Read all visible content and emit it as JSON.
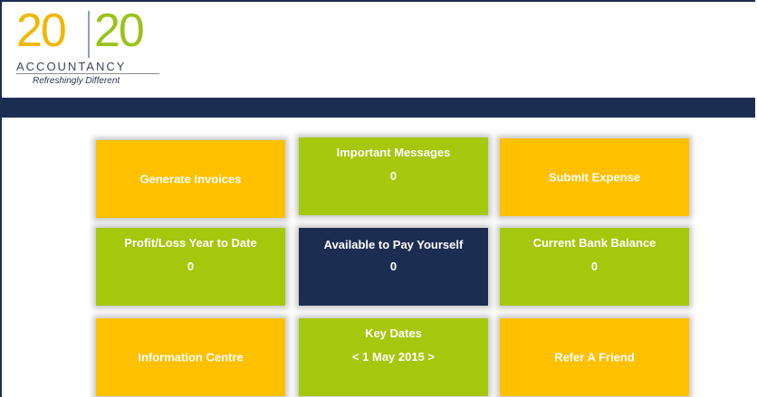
{
  "branding": {
    "logo_left": "20",
    "logo_right": "20",
    "company": "ACCOUNTANCY",
    "tagline": "Refreshingly Different"
  },
  "colors": {
    "navy": "#1c2d52",
    "orange": "#ffc000",
    "green": "#a5c70c",
    "logo_gold": "#f2b600",
    "logo_green": "#9bc21a"
  },
  "tiles": {
    "generate_invoices": {
      "label": "Generate Invoices"
    },
    "important_messages": {
      "title": "Important Messages",
      "value": "0"
    },
    "submit_expense": {
      "label": "Submit Expense"
    },
    "profit_loss": {
      "title": "Profit/Loss Year to Date",
      "value": "0"
    },
    "available_pay": {
      "title": "Available to Pay Yourself",
      "value": "0"
    },
    "bank_balance": {
      "title": "Current Bank Balance",
      "value": "0"
    },
    "information_centre": {
      "label": "Information Centre"
    },
    "key_dates": {
      "title": "Key Dates",
      "value": "< 1 May 2015 >"
    },
    "refer_friend": {
      "label": "Refer A Friend"
    }
  }
}
